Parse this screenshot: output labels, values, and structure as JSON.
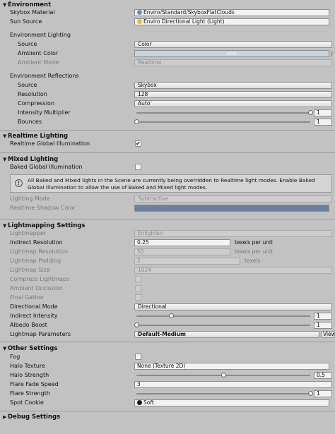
{
  "environment": {
    "header": "Environment",
    "skybox_material_label": "Skybox Material",
    "skybox_material_value": "Enviro/Standard/SkyboxFlatClouds",
    "sun_source_label": "Sun Source",
    "sun_source_value": "Enviro Directional Light (Light)",
    "env_lighting_label": "Environment Lighting",
    "source_label": "Source",
    "source_value": "Color",
    "ambient_color_label": "Ambient Color",
    "ambient_color_badge": "HDR",
    "ambient_mode_label": "Ambient Mode",
    "ambient_mode_value": "Realtime",
    "env_reflections_label": "Environment Reflections",
    "refl_source_label": "Source",
    "refl_source_value": "Skybox",
    "resolution_label": "Resolution",
    "resolution_value": "128",
    "compression_label": "Compression",
    "compression_value": "Auto",
    "intensity_label": "Intensity Multiplier",
    "intensity_value": "1",
    "bounces_label": "Bounces",
    "bounces_value": "1"
  },
  "realtime": {
    "header": "Realtime Lighting",
    "rgi_label": "Realtime Global Illumination",
    "rgi_checked": true,
    "check_glyph": "✔"
  },
  "mixed": {
    "header": "Mixed Lighting",
    "bgi_label": "Baked Global Illumination",
    "info_text": "All Baked and Mixed lights in the Scene are currently being overridden to Realtime light modes. Enable Baked Global Illumination to allow the use of Baked and Mixed light modes.",
    "lighting_mode_label": "Lighting Mode",
    "lighting_mode_value": "Subtractive",
    "shadow_color_label": "Realtime Shadow Color"
  },
  "lightmapping": {
    "header": "Lightmapping Settings",
    "lightmapper_label": "Lightmapper",
    "lightmapper_value": "Enlighten",
    "indirect_res_label": "Indirect Resolution",
    "indirect_res_value": "0.25",
    "texels_unit": "texels per unit",
    "lm_res_label": "Lightmap Resolution",
    "lm_res_value": "50",
    "lm_pad_label": "Lightmap Padding",
    "lm_pad_value": "2",
    "texels_short": "texels",
    "lm_size_label": "Lightmap Size",
    "lm_size_value": "1024",
    "compress_label": "Compress Lightmaps",
    "ao_label": "Ambient Occlusion",
    "final_gather_label": "Final Gather",
    "dir_mode_label": "Directional Mode",
    "dir_mode_value": "Directional",
    "indirect_int_label": "Indirect Intensity",
    "indirect_int_value": "1",
    "albedo_label": "Albedo Boost",
    "albedo_value": "1",
    "params_label": "Lightmap Parameters",
    "params_value": "Default-Medium",
    "view_button": "View"
  },
  "other": {
    "header": "Other Settings",
    "fog_label": "Fog",
    "halo_tex_label": "Halo Texture",
    "halo_tex_value": "None (Texture 2D)",
    "halo_str_label": "Halo Strength",
    "halo_str_value": "0.5",
    "flare_fade_label": "Flare Fade Speed",
    "flare_fade_value": "3",
    "flare_str_label": "Flare Strength",
    "flare_str_value": "1",
    "spot_cookie_label": "Spot Cookie",
    "spot_cookie_value": "Soft"
  },
  "debug": {
    "header": "Debug Settings"
  },
  "colors": {
    "ambient_color": "#c8d4de",
    "shadow_color": "#6b7fa0",
    "panel_bg": "#c2c2c2"
  },
  "sliders": {
    "intensity_multiplier": 1,
    "bounces": 0,
    "indirect_intensity": 0.2,
    "albedo_boost": 0,
    "halo_strength": 0.5,
    "flare_strength": 1
  }
}
